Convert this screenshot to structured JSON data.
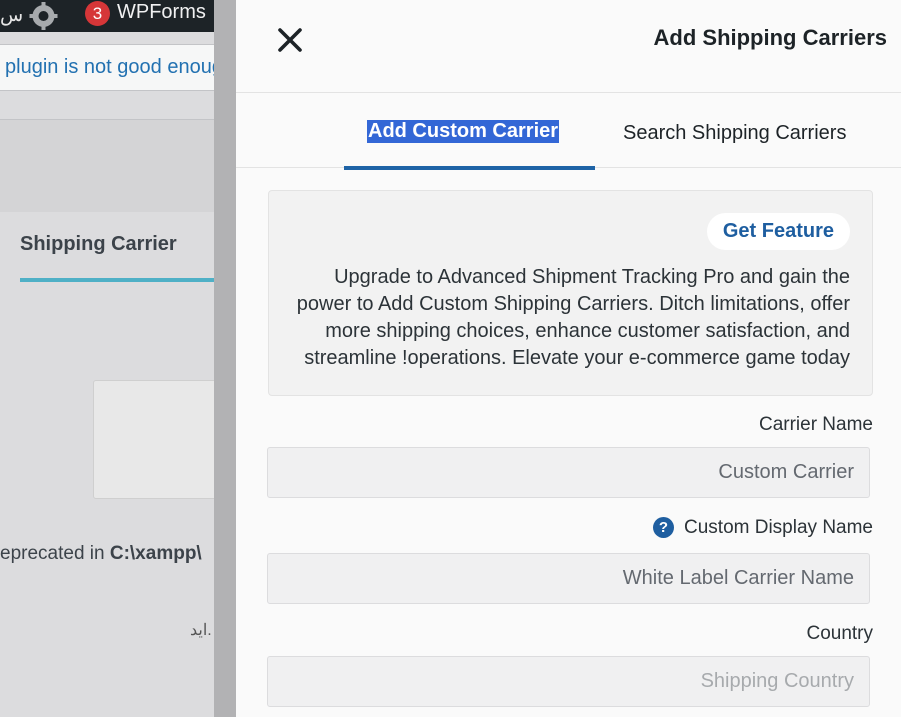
{
  "background": {
    "adminbar": {
      "left_text": "س",
      "notification_count": "3",
      "wpforms_label": "WPForms"
    },
    "notice_text": "plugin is not good enoug",
    "tab_label": "Shipping Carrier",
    "deprecated_prefix": "eprecated in ",
    "deprecated_path": "C:\\xampp\\",
    "rtl_text": "اید."
  },
  "panel": {
    "title": "Add Shipping Carriers",
    "close_icon": "close-x-icon",
    "tabs": [
      {
        "label": "Add Custom Carrier",
        "active": true
      },
      {
        "label": "Search Shipping Carriers",
        "active": false
      }
    ],
    "promo": {
      "button_label": "Get Feature",
      "text": "Upgrade to Advanced Shipment Tracking Pro and gain the power to Add Custom Shipping Carriers. Ditch limitations, offer more shipping choices, enhance customer satisfaction, and streamline !operations. Elevate your e-commerce game today"
    },
    "fields": {
      "carrier_name": {
        "label": "Carrier Name",
        "placeholder": "Custom Carrier",
        "value": ""
      },
      "display_name": {
        "label": "Custom Display Name",
        "placeholder": "White Label Carrier Name",
        "value": "",
        "help_icon": "question-circle-icon"
      },
      "country": {
        "label": "Country",
        "placeholder": "Shipping Country",
        "value": ""
      }
    },
    "colors": {
      "accent": "#1e63a6",
      "selection": "#3367d6",
      "badge": "#d63638"
    }
  }
}
